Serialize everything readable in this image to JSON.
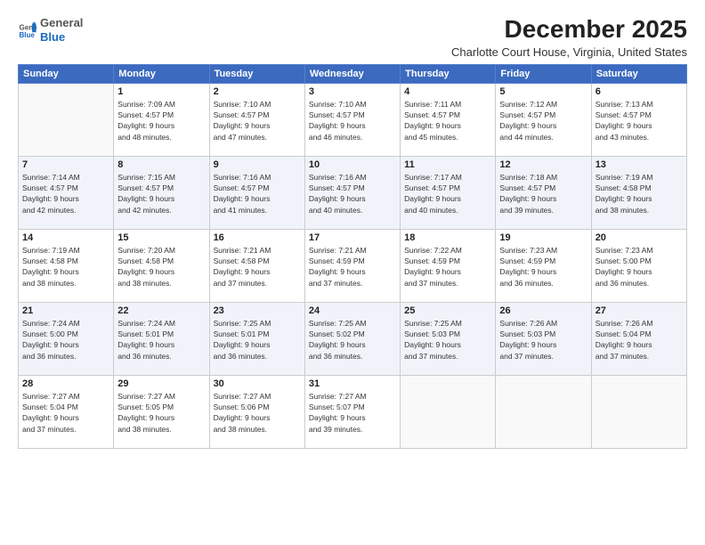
{
  "logo": {
    "general": "General",
    "blue": "Blue"
  },
  "header": {
    "month": "December 2025",
    "location": "Charlotte Court House, Virginia, United States"
  },
  "weekdays": [
    "Sunday",
    "Monday",
    "Tuesday",
    "Wednesday",
    "Thursday",
    "Friday",
    "Saturday"
  ],
  "weeks": [
    [
      {
        "day": "",
        "info": ""
      },
      {
        "day": "1",
        "info": "Sunrise: 7:09 AM\nSunset: 4:57 PM\nDaylight: 9 hours\nand 48 minutes."
      },
      {
        "day": "2",
        "info": "Sunrise: 7:10 AM\nSunset: 4:57 PM\nDaylight: 9 hours\nand 47 minutes."
      },
      {
        "day": "3",
        "info": "Sunrise: 7:10 AM\nSunset: 4:57 PM\nDaylight: 9 hours\nand 46 minutes."
      },
      {
        "day": "4",
        "info": "Sunrise: 7:11 AM\nSunset: 4:57 PM\nDaylight: 9 hours\nand 45 minutes."
      },
      {
        "day": "5",
        "info": "Sunrise: 7:12 AM\nSunset: 4:57 PM\nDaylight: 9 hours\nand 44 minutes."
      },
      {
        "day": "6",
        "info": "Sunrise: 7:13 AM\nSunset: 4:57 PM\nDaylight: 9 hours\nand 43 minutes."
      }
    ],
    [
      {
        "day": "7",
        "info": "Sunrise: 7:14 AM\nSunset: 4:57 PM\nDaylight: 9 hours\nand 42 minutes."
      },
      {
        "day": "8",
        "info": "Sunrise: 7:15 AM\nSunset: 4:57 PM\nDaylight: 9 hours\nand 42 minutes."
      },
      {
        "day": "9",
        "info": "Sunrise: 7:16 AM\nSunset: 4:57 PM\nDaylight: 9 hours\nand 41 minutes."
      },
      {
        "day": "10",
        "info": "Sunrise: 7:16 AM\nSunset: 4:57 PM\nDaylight: 9 hours\nand 40 minutes."
      },
      {
        "day": "11",
        "info": "Sunrise: 7:17 AM\nSunset: 4:57 PM\nDaylight: 9 hours\nand 40 minutes."
      },
      {
        "day": "12",
        "info": "Sunrise: 7:18 AM\nSunset: 4:57 PM\nDaylight: 9 hours\nand 39 minutes."
      },
      {
        "day": "13",
        "info": "Sunrise: 7:19 AM\nSunset: 4:58 PM\nDaylight: 9 hours\nand 38 minutes."
      }
    ],
    [
      {
        "day": "14",
        "info": "Sunrise: 7:19 AM\nSunset: 4:58 PM\nDaylight: 9 hours\nand 38 minutes."
      },
      {
        "day": "15",
        "info": "Sunrise: 7:20 AM\nSunset: 4:58 PM\nDaylight: 9 hours\nand 38 minutes."
      },
      {
        "day": "16",
        "info": "Sunrise: 7:21 AM\nSunset: 4:58 PM\nDaylight: 9 hours\nand 37 minutes."
      },
      {
        "day": "17",
        "info": "Sunrise: 7:21 AM\nSunset: 4:59 PM\nDaylight: 9 hours\nand 37 minutes."
      },
      {
        "day": "18",
        "info": "Sunrise: 7:22 AM\nSunset: 4:59 PM\nDaylight: 9 hours\nand 37 minutes."
      },
      {
        "day": "19",
        "info": "Sunrise: 7:23 AM\nSunset: 4:59 PM\nDaylight: 9 hours\nand 36 minutes."
      },
      {
        "day": "20",
        "info": "Sunrise: 7:23 AM\nSunset: 5:00 PM\nDaylight: 9 hours\nand 36 minutes."
      }
    ],
    [
      {
        "day": "21",
        "info": "Sunrise: 7:24 AM\nSunset: 5:00 PM\nDaylight: 9 hours\nand 36 minutes."
      },
      {
        "day": "22",
        "info": "Sunrise: 7:24 AM\nSunset: 5:01 PM\nDaylight: 9 hours\nand 36 minutes."
      },
      {
        "day": "23",
        "info": "Sunrise: 7:25 AM\nSunset: 5:01 PM\nDaylight: 9 hours\nand 36 minutes."
      },
      {
        "day": "24",
        "info": "Sunrise: 7:25 AM\nSunset: 5:02 PM\nDaylight: 9 hours\nand 36 minutes."
      },
      {
        "day": "25",
        "info": "Sunrise: 7:25 AM\nSunset: 5:03 PM\nDaylight: 9 hours\nand 37 minutes."
      },
      {
        "day": "26",
        "info": "Sunrise: 7:26 AM\nSunset: 5:03 PM\nDaylight: 9 hours\nand 37 minutes."
      },
      {
        "day": "27",
        "info": "Sunrise: 7:26 AM\nSunset: 5:04 PM\nDaylight: 9 hours\nand 37 minutes."
      }
    ],
    [
      {
        "day": "28",
        "info": "Sunrise: 7:27 AM\nSunset: 5:04 PM\nDaylight: 9 hours\nand 37 minutes."
      },
      {
        "day": "29",
        "info": "Sunrise: 7:27 AM\nSunset: 5:05 PM\nDaylight: 9 hours\nand 38 minutes."
      },
      {
        "day": "30",
        "info": "Sunrise: 7:27 AM\nSunset: 5:06 PM\nDaylight: 9 hours\nand 38 minutes."
      },
      {
        "day": "31",
        "info": "Sunrise: 7:27 AM\nSunset: 5:07 PM\nDaylight: 9 hours\nand 39 minutes."
      },
      {
        "day": "",
        "info": ""
      },
      {
        "day": "",
        "info": ""
      },
      {
        "day": "",
        "info": ""
      }
    ]
  ]
}
